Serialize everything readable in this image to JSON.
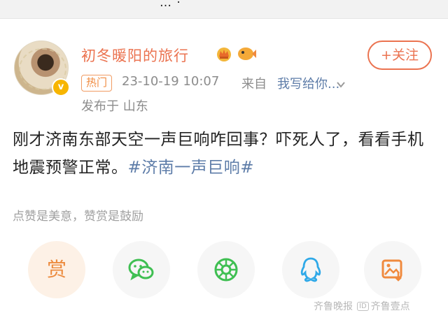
{
  "top_strip": {
    "partial_text": "… ·"
  },
  "post": {
    "author": "初冬暖阳的旅行",
    "follow_label": "+关注",
    "hot_badge": "热门",
    "time": "23-10-19 10:07",
    "from_label": "来自",
    "source": "我写给你...",
    "location": "发布于 山东",
    "text": "刚才济南东部天空一声巨响咋回事？吓死人了，看看手机地震预警正常。",
    "hashtag": "#济南一声巨响#"
  },
  "reward": {
    "hint": "点赞是美意，赞赏是鼓励",
    "button_label": "赏"
  },
  "share_icons": [
    "reward-icon",
    "wechat-icon",
    "moments-icon",
    "qq-icon",
    "save-image-icon"
  ],
  "watermark": {
    "left": "齐鲁晚报",
    "box": "ID",
    "right": "齐鲁壹点"
  },
  "colors": {
    "accent": "#eb7350",
    "link": "#5d7ca8",
    "wechat": "#3fbf52",
    "moments": "#3fbf52",
    "qq": "#2fa9e8",
    "save": "#f08a3e"
  }
}
